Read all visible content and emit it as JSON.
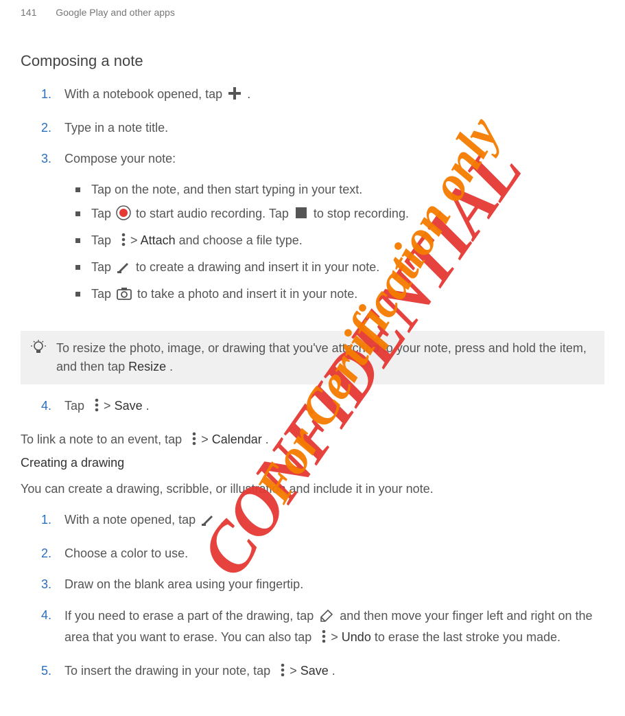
{
  "header": {
    "page_number": "141",
    "chapter": "Google Play and other apps"
  },
  "s1": {
    "title": "Composing a note",
    "step1a": "With a notebook opened, tap ",
    "step1b": ".",
    "step2": "Type in a note title.",
    "step3": "Compose your note:",
    "b1": "Tap on the note, and then start typing in your text.",
    "b2a": "Tap ",
    "b2b": " to start audio recording. Tap ",
    "b2c": " to stop recording.",
    "b3a": "Tap ",
    "b3b": " > ",
    "b3c": "Attach",
    "b3d": " and choose a file type.",
    "b4a": "Tap ",
    "b4b": " to create a drawing and insert it in your note.",
    "b5a": "Tap ",
    "b5b": " to take a photo and insert it in your note.",
    "tip_a": "To resize the photo, image, or drawing that you've attached to your note, press and hold the item, and then tap ",
    "tip_b": "Resize",
    "tip_c": ".",
    "step4a": "Tap ",
    "step4b": " > ",
    "step4c": "Save",
    "step4d": ".",
    "link_a": "To link a note to an event, tap ",
    "link_b": " > ",
    "link_c": "Calendar",
    "link_d": "."
  },
  "s2": {
    "title": "Creating a drawing",
    "intro": "You can create a drawing, scribble, or illustration and include it in your note.",
    "step1a": "With a note opened, tap ",
    "step1b": ".",
    "step2": "Choose a color to use.",
    "step3": "Draw on the blank area using your fingertip.",
    "step4a": "If you need to erase a part of the drawing, tap ",
    "step4b": " and then move your finger left and right on the area that you want to erase. You can also tap ",
    "step4c": " > ",
    "step4d": "Undo",
    "step4e": " to erase the last stroke you made.",
    "step5a": "To insert the drawing in your note, tap ",
    "step5b": " > ",
    "step5c": "Save",
    "step5d": "."
  },
  "watermarks": {
    "red": "CONFIDENTIAL",
    "orange": "For Certification only"
  },
  "icons": {
    "plus": "plus-icon",
    "record": "record-icon",
    "stop": "stop-icon",
    "menu": "menu-dots-icon",
    "brush": "brush-icon",
    "camera": "camera-icon",
    "bulb": "lightbulb-icon",
    "eraser": "eraser-icon"
  }
}
